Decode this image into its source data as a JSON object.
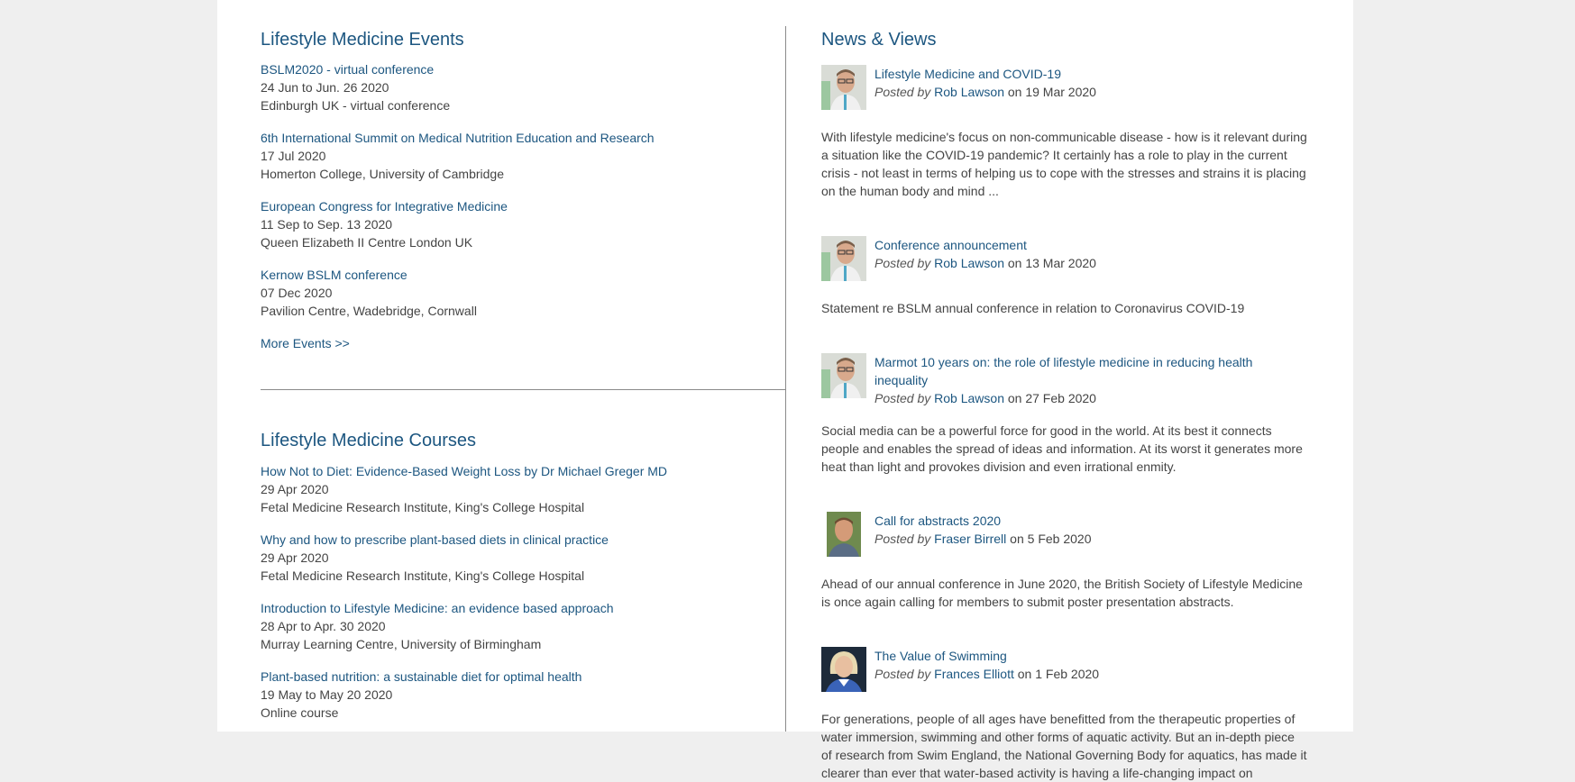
{
  "events": {
    "title": "Lifestyle Medicine Events",
    "items": [
      {
        "title": "BSLM2020 - virtual conference",
        "date": "24 Jun to Jun. 26 2020",
        "location": "Edinburgh UK - virtual conference"
      },
      {
        "title": "6th International Summit on Medical Nutrition Education and Research",
        "date": "17 Jul 2020",
        "location": "Homerton College, University of Cambridge"
      },
      {
        "title": "European Congress for Integrative Medicine",
        "date": "11 Sep to Sep. 13 2020",
        "location": "Queen Elizabeth II Centre London UK"
      },
      {
        "title": "Kernow BSLM conference",
        "date": "07 Dec 2020",
        "location": "Pavilion Centre, Wadebridge, Cornwall"
      }
    ],
    "more_link": "More Events >>"
  },
  "courses": {
    "title": "Lifestyle Medicine Courses",
    "items": [
      {
        "title": "How Not to Diet: Evidence-Based Weight Loss by Dr Michael Greger MD",
        "date": "29 Apr 2020",
        "location": "Fetal Medicine Research Institute, King's College Hospital"
      },
      {
        "title": "Why and how to prescribe plant-based diets in clinical practice",
        "date": "29 Apr 2020",
        "location": "Fetal Medicine Research Institute, King's College Hospital"
      },
      {
        "title": "Introduction to Lifestyle Medicine: an evidence based approach",
        "date": "28 Apr to Apr. 30 2020",
        "location": "Murray Learning Centre, University of Birmingham"
      },
      {
        "title": "Plant-based nutrition: a sustainable diet for optimal health",
        "date": "19 May to May 20 2020",
        "location": "Online course"
      }
    ]
  },
  "news": {
    "title": "News & Views",
    "posted_by_label": "Posted by",
    "on_label": "on",
    "items": [
      {
        "title": "Lifestyle Medicine and COVID-19",
        "author": "Rob Lawson",
        "date": "19 Mar 2020",
        "avatar": "rob-lawson-avatar",
        "excerpt": "With lifestyle medicine's focus on non-communicable disease - how is it relevant during a situation like the COVID-19 pandemic? It certainly has a role to play in the current crisis - not least in terms of helping us to cope with the stresses and strains it is placing on the human body and mind ..."
      },
      {
        "title": "Conference announcement",
        "author": "Rob Lawson",
        "date": "13 Mar 2020",
        "avatar": "rob-lawson-avatar",
        "excerpt": "Statement re BSLM annual conference in relation to Coronavirus COVID-19"
      },
      {
        "title": "Marmot 10 years on: the role of lifestyle medicine in reducing health inequality",
        "author": "Rob Lawson",
        "date": "27 Feb 2020",
        "avatar": "rob-lawson-avatar",
        "excerpt": "Social media can be a powerful force for good in the world. At its best it connects people and enables the spread of ideas and information. At its worst it generates more heat than light and provokes division and even irrational enmity."
      },
      {
        "title": "Call for abstracts 2020",
        "author": "Fraser Birrell",
        "date": "5 Feb 2020",
        "avatar": "fraser-birrell-avatar",
        "excerpt": "Ahead of our annual conference in June 2020, the British Society of Lifestyle Medicine is once again calling for members to submit poster presentation abstracts."
      },
      {
        "title": "The Value of Swimming",
        "author": "Frances Elliott",
        "date": "1 Feb 2020",
        "avatar": "frances-elliott-avatar",
        "excerpt": "For generations, people of all ages have benefitted from the therapeutic properties of water immersion, swimming and other forms of aquatic activity. But an in-depth piece of research from Swim England, the National Governing Body for aquatics, has made it clearer than ever that water-based activity is having a life-changing impact on"
      }
    ]
  },
  "colors": {
    "link": "#1c5680",
    "text": "#444444",
    "page_bg": "#efefef",
    "content_bg": "#ffffff",
    "divider": "#8a8a8a"
  }
}
